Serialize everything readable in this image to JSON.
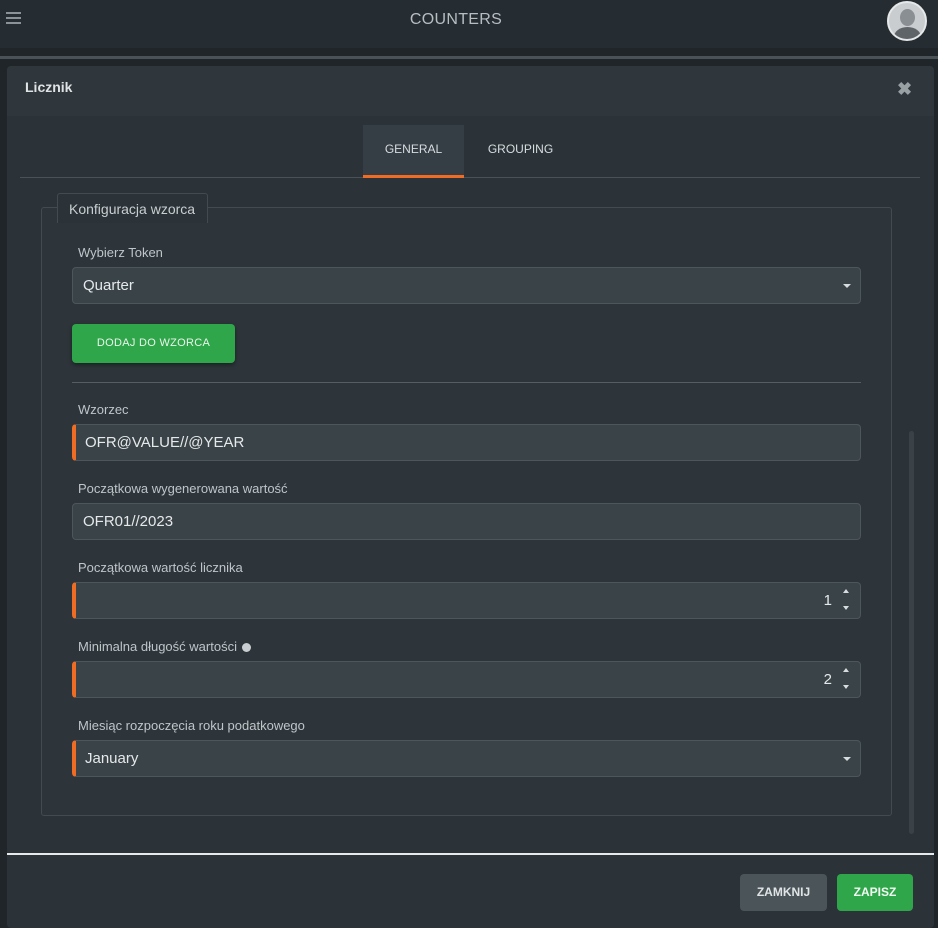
{
  "app": {
    "title": "COUNTERS"
  },
  "modal": {
    "title": "Licznik",
    "close_icon": "✖",
    "tabs": [
      {
        "label": "GENERAL",
        "active": true
      },
      {
        "label": "GROUPING",
        "active": false
      }
    ],
    "section_legend": "Konfiguracja wzorca",
    "token": {
      "label": "Wybierz Token",
      "value": "Quarter"
    },
    "add_button": "DODAJ DO WZORCA",
    "pattern": {
      "label": "Wzorzec",
      "value": "OFR@VALUE//@YEAR"
    },
    "initial_generated": {
      "label": "Początkowa wygenerowana wartość",
      "value": "OFR01//2023"
    },
    "initial_counter": {
      "label": "Początkowa wartość licznika",
      "value": "1"
    },
    "min_length": {
      "label": "Minimalna długość wartości",
      "value": "2"
    },
    "fiscal_month": {
      "label": "Miesiąc rozpoczęcia roku podatkowego",
      "value": "January"
    },
    "footer": {
      "close_label": "ZAMKNIJ",
      "save_label": "ZAPISZ"
    }
  },
  "colors": {
    "accent": "#ef6c24",
    "success": "#2fa64a",
    "background": "#2b3338"
  }
}
